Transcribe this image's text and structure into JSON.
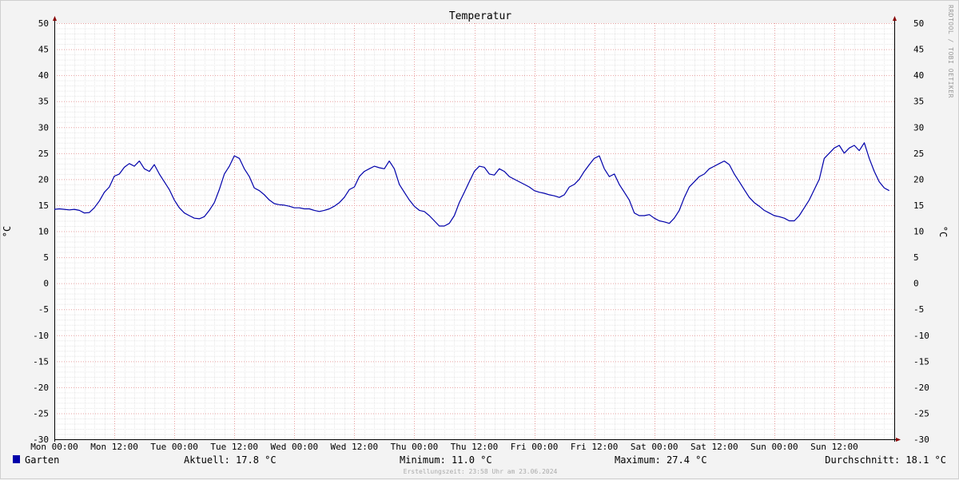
{
  "chart_data": {
    "type": "line",
    "title": "Temperatur",
    "ylabel": "°C",
    "ylabel_right": "°C",
    "ylim": [
      -30,
      50
    ],
    "yticks": [
      50,
      45,
      40,
      35,
      30,
      25,
      20,
      15,
      10,
      5,
      0,
      -5,
      -10,
      -15,
      -20,
      -25,
      -30
    ],
    "x_tick_labels": [
      "Mon 00:00",
      "Mon 12:00",
      "Tue 00:00",
      "Tue 12:00",
      "Wed 00:00",
      "Wed 12:00",
      "Thu 00:00",
      "Thu 12:00",
      "Fri 00:00",
      "Fri 12:00",
      "Sat 00:00",
      "Sat 12:00",
      "Sun 00:00",
      "Sun 12:00"
    ],
    "x_range_hours": [
      0,
      168
    ],
    "grid": true,
    "series": [
      {
        "name": "Garten",
        "color": "#0000aa",
        "x_hours": [
          0,
          1,
          2,
          3,
          4,
          5,
          6,
          7,
          8,
          9,
          10,
          11,
          12,
          13,
          14,
          15,
          16,
          17,
          18,
          19,
          20,
          21,
          22,
          23,
          24,
          25,
          26,
          27,
          28,
          29,
          30,
          31,
          32,
          33,
          34,
          35,
          36,
          37,
          38,
          39,
          40,
          41,
          42,
          43,
          44,
          45,
          46,
          47,
          48,
          49,
          50,
          51,
          52,
          53,
          54,
          55,
          56,
          57,
          58,
          59,
          60,
          61,
          62,
          63,
          64,
          65,
          66,
          67,
          68,
          69,
          70,
          71,
          72,
          73,
          74,
          75,
          76,
          77,
          78,
          79,
          80,
          81,
          82,
          83,
          84,
          85,
          86,
          87,
          88,
          89,
          90,
          91,
          92,
          93,
          94,
          95,
          96,
          97,
          98,
          99,
          100,
          101,
          102,
          103,
          104,
          105,
          106,
          107,
          108,
          109,
          110,
          111,
          112,
          113,
          114,
          115,
          116,
          117,
          118,
          119,
          120,
          121,
          122,
          123,
          124,
          125,
          126,
          127,
          128,
          129,
          130,
          131,
          132,
          133,
          134,
          135,
          136,
          137,
          138,
          139,
          140,
          141,
          142,
          143,
          144,
          145,
          146,
          147,
          148,
          149,
          150,
          151,
          152,
          153,
          154,
          155,
          156,
          157,
          158,
          159,
          160,
          161,
          162,
          163,
          164,
          165,
          166,
          167,
          168
        ],
        "values": [
          14.2,
          14.3,
          14.2,
          14.1,
          14.2,
          14.0,
          13.5,
          13.6,
          14.5,
          15.8,
          17.5,
          18.5,
          20.6,
          21.0,
          22.3,
          23.0,
          22.5,
          23.5,
          22.0,
          21.5,
          22.8,
          21.0,
          19.5,
          18.0,
          16.0,
          14.5,
          13.5,
          13.0,
          12.5,
          12.4,
          12.8,
          14.0,
          15.5,
          18.0,
          21.0,
          22.5,
          24.5,
          24.0,
          22.0,
          20.5,
          18.3,
          17.8,
          17.0,
          16.0,
          15.3,
          15.1,
          15.0,
          14.8,
          14.5,
          14.5,
          14.3,
          14.3,
          14.0,
          13.8,
          14.0,
          14.3,
          14.8,
          15.5,
          16.5,
          18.0,
          18.5,
          20.5,
          21.5,
          22.0,
          22.5,
          22.2,
          22.0,
          23.5,
          22.0,
          19.0,
          17.5,
          16.0,
          14.8,
          14.0,
          13.8,
          13.0,
          12.0,
          11.0,
          11.0,
          11.5,
          13.0,
          15.5,
          17.5,
          19.5,
          21.5,
          22.5,
          22.3,
          21.0,
          20.8,
          22.0,
          21.5,
          20.5,
          20.0,
          19.5,
          19.0,
          18.5,
          17.8,
          17.5,
          17.3,
          17.0,
          16.8,
          16.5,
          17.0,
          18.5,
          19.0,
          20.0,
          21.5,
          22.8,
          24.0,
          24.5,
          22.0,
          20.5,
          21.0,
          19.0,
          17.5,
          16.0,
          13.5,
          13.0,
          13.0,
          13.2,
          12.5,
          12.0,
          11.8,
          11.5,
          12.5,
          14.0,
          16.5,
          18.5,
          19.5,
          20.5,
          21.0,
          22.0,
          22.5,
          23.0,
          23.5,
          22.8,
          21.0,
          19.5,
          18.0,
          16.5,
          15.5,
          14.8,
          14.0,
          13.5,
          13.0,
          12.8,
          12.5,
          12.0,
          12.0,
          13.0,
          14.5,
          16.0,
          18.0,
          20.0,
          24.0,
          25.0,
          26.0,
          26.5,
          25.0,
          26.0,
          26.5,
          25.5,
          27.0,
          24.0,
          21.5,
          19.5,
          18.3,
          17.8
        ]
      }
    ]
  },
  "side_text": "RRDTOOL / TOBI OETIKER",
  "legend": {
    "series_name": "Garten",
    "color": "#0000aa",
    "current": "Aktuell: 17.8 °C",
    "minimum": "Minimum: 11.0 °C",
    "maximum": "Maximum: 27.4 °C",
    "average": "Durchschnitt: 18.1 °C"
  },
  "footer": "Erstellungszeit: 23:58 Uhr am 23.06.2024"
}
